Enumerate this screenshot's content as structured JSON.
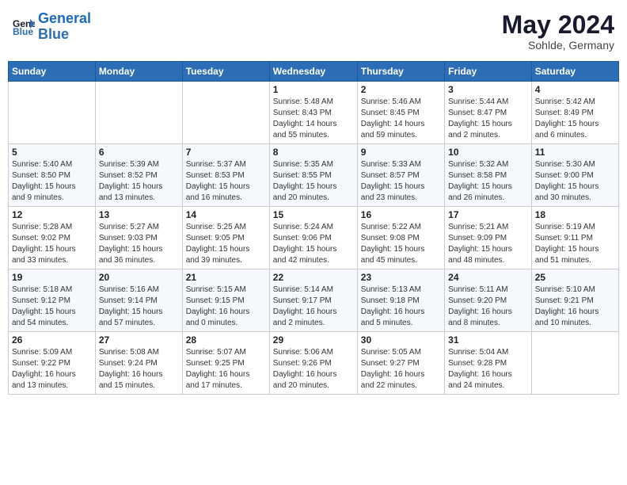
{
  "header": {
    "logo_line1": "General",
    "logo_line2": "Blue",
    "month_title": "May 2024",
    "location": "Sohlde, Germany"
  },
  "weekdays": [
    "Sunday",
    "Monday",
    "Tuesday",
    "Wednesday",
    "Thursday",
    "Friday",
    "Saturday"
  ],
  "weeks": [
    [
      {
        "day": "",
        "info": ""
      },
      {
        "day": "",
        "info": ""
      },
      {
        "day": "",
        "info": ""
      },
      {
        "day": "1",
        "info": "Sunrise: 5:48 AM\nSunset: 8:43 PM\nDaylight: 14 hours\nand 55 minutes."
      },
      {
        "day": "2",
        "info": "Sunrise: 5:46 AM\nSunset: 8:45 PM\nDaylight: 14 hours\nand 59 minutes."
      },
      {
        "day": "3",
        "info": "Sunrise: 5:44 AM\nSunset: 8:47 PM\nDaylight: 15 hours\nand 2 minutes."
      },
      {
        "day": "4",
        "info": "Sunrise: 5:42 AM\nSunset: 8:49 PM\nDaylight: 15 hours\nand 6 minutes."
      }
    ],
    [
      {
        "day": "5",
        "info": "Sunrise: 5:40 AM\nSunset: 8:50 PM\nDaylight: 15 hours\nand 9 minutes."
      },
      {
        "day": "6",
        "info": "Sunrise: 5:39 AM\nSunset: 8:52 PM\nDaylight: 15 hours\nand 13 minutes."
      },
      {
        "day": "7",
        "info": "Sunrise: 5:37 AM\nSunset: 8:53 PM\nDaylight: 15 hours\nand 16 minutes."
      },
      {
        "day": "8",
        "info": "Sunrise: 5:35 AM\nSunset: 8:55 PM\nDaylight: 15 hours\nand 20 minutes."
      },
      {
        "day": "9",
        "info": "Sunrise: 5:33 AM\nSunset: 8:57 PM\nDaylight: 15 hours\nand 23 minutes."
      },
      {
        "day": "10",
        "info": "Sunrise: 5:32 AM\nSunset: 8:58 PM\nDaylight: 15 hours\nand 26 minutes."
      },
      {
        "day": "11",
        "info": "Sunrise: 5:30 AM\nSunset: 9:00 PM\nDaylight: 15 hours\nand 30 minutes."
      }
    ],
    [
      {
        "day": "12",
        "info": "Sunrise: 5:28 AM\nSunset: 9:02 PM\nDaylight: 15 hours\nand 33 minutes."
      },
      {
        "day": "13",
        "info": "Sunrise: 5:27 AM\nSunset: 9:03 PM\nDaylight: 15 hours\nand 36 minutes."
      },
      {
        "day": "14",
        "info": "Sunrise: 5:25 AM\nSunset: 9:05 PM\nDaylight: 15 hours\nand 39 minutes."
      },
      {
        "day": "15",
        "info": "Sunrise: 5:24 AM\nSunset: 9:06 PM\nDaylight: 15 hours\nand 42 minutes."
      },
      {
        "day": "16",
        "info": "Sunrise: 5:22 AM\nSunset: 9:08 PM\nDaylight: 15 hours\nand 45 minutes."
      },
      {
        "day": "17",
        "info": "Sunrise: 5:21 AM\nSunset: 9:09 PM\nDaylight: 15 hours\nand 48 minutes."
      },
      {
        "day": "18",
        "info": "Sunrise: 5:19 AM\nSunset: 9:11 PM\nDaylight: 15 hours\nand 51 minutes."
      }
    ],
    [
      {
        "day": "19",
        "info": "Sunrise: 5:18 AM\nSunset: 9:12 PM\nDaylight: 15 hours\nand 54 minutes."
      },
      {
        "day": "20",
        "info": "Sunrise: 5:16 AM\nSunset: 9:14 PM\nDaylight: 15 hours\nand 57 minutes."
      },
      {
        "day": "21",
        "info": "Sunrise: 5:15 AM\nSunset: 9:15 PM\nDaylight: 16 hours\nand 0 minutes."
      },
      {
        "day": "22",
        "info": "Sunrise: 5:14 AM\nSunset: 9:17 PM\nDaylight: 16 hours\nand 2 minutes."
      },
      {
        "day": "23",
        "info": "Sunrise: 5:13 AM\nSunset: 9:18 PM\nDaylight: 16 hours\nand 5 minutes."
      },
      {
        "day": "24",
        "info": "Sunrise: 5:11 AM\nSunset: 9:20 PM\nDaylight: 16 hours\nand 8 minutes."
      },
      {
        "day": "25",
        "info": "Sunrise: 5:10 AM\nSunset: 9:21 PM\nDaylight: 16 hours\nand 10 minutes."
      }
    ],
    [
      {
        "day": "26",
        "info": "Sunrise: 5:09 AM\nSunset: 9:22 PM\nDaylight: 16 hours\nand 13 minutes."
      },
      {
        "day": "27",
        "info": "Sunrise: 5:08 AM\nSunset: 9:24 PM\nDaylight: 16 hours\nand 15 minutes."
      },
      {
        "day": "28",
        "info": "Sunrise: 5:07 AM\nSunset: 9:25 PM\nDaylight: 16 hours\nand 17 minutes."
      },
      {
        "day": "29",
        "info": "Sunrise: 5:06 AM\nSunset: 9:26 PM\nDaylight: 16 hours\nand 20 minutes."
      },
      {
        "day": "30",
        "info": "Sunrise: 5:05 AM\nSunset: 9:27 PM\nDaylight: 16 hours\nand 22 minutes."
      },
      {
        "day": "31",
        "info": "Sunrise: 5:04 AM\nSunset: 9:28 PM\nDaylight: 16 hours\nand 24 minutes."
      },
      {
        "day": "",
        "info": ""
      }
    ]
  ]
}
